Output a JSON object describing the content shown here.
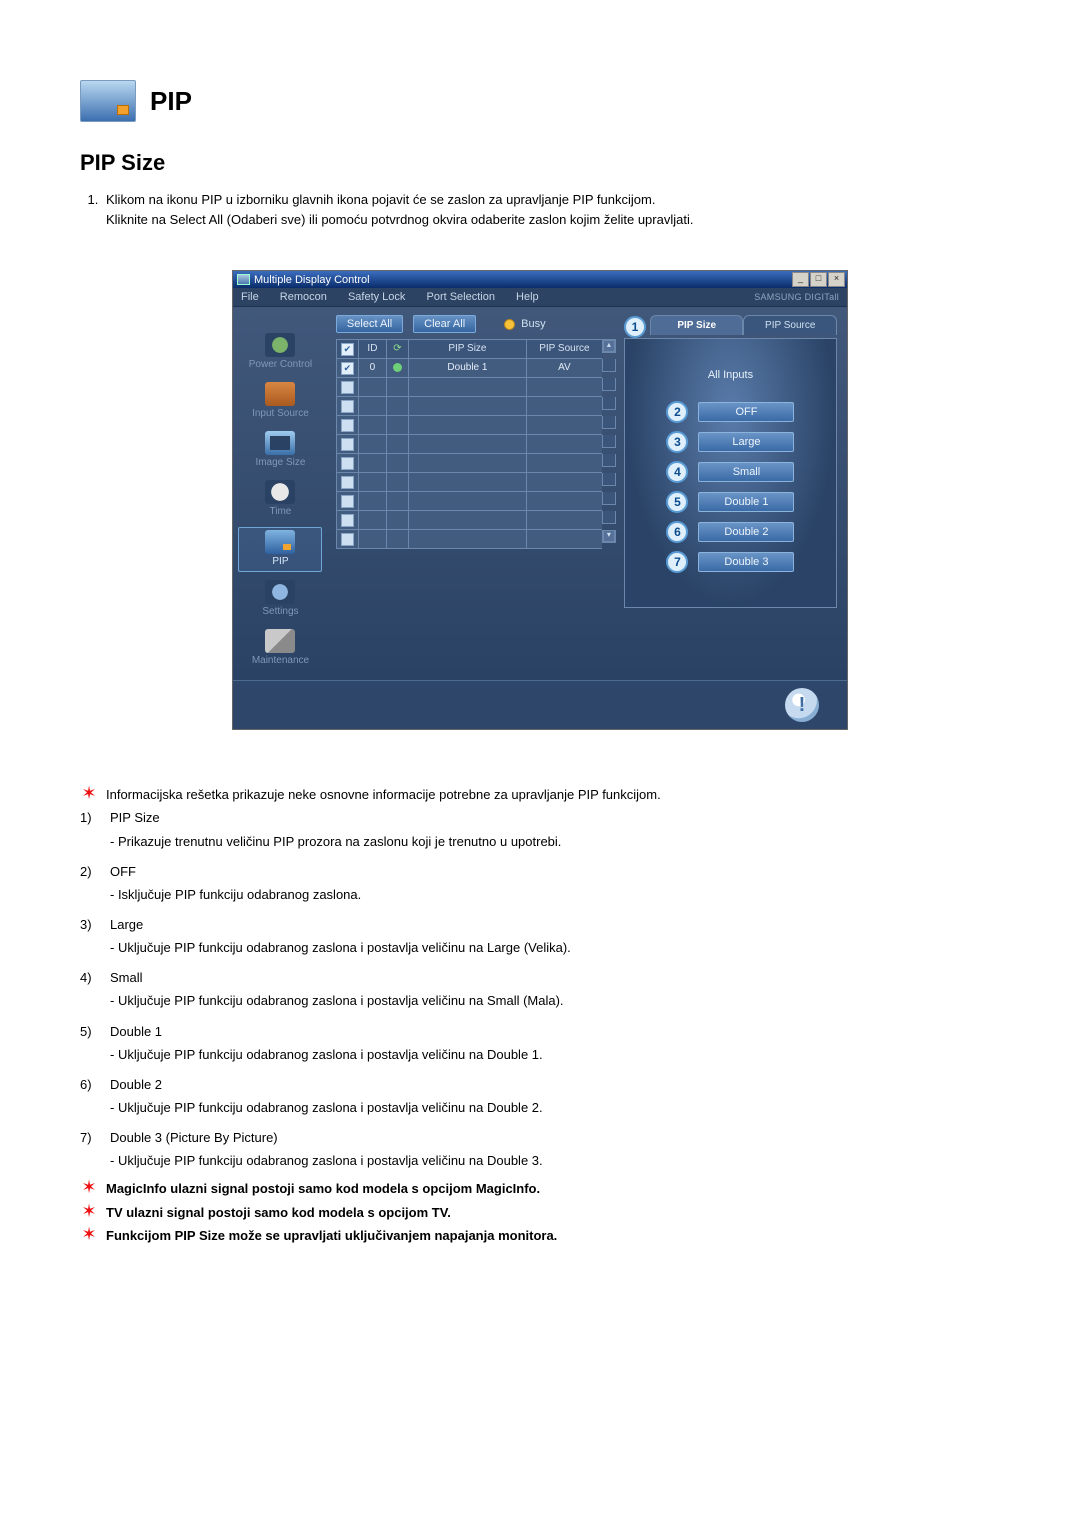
{
  "header": {
    "title": "PIP"
  },
  "section": {
    "title": "PIP Size"
  },
  "intro": {
    "item1": "Klikom na ikonu PIP u izborniku glavnih ikona pojavit će se zaslon za upravljanje PIP funkcijom.\nKliknite na Select All (Odaberi sve) ili pomoću potvrdnog okvira odaberite zaslon kojim želite upravljati."
  },
  "app": {
    "title": "Multiple Display Control",
    "menus": [
      "File",
      "Remocon",
      "Safety Lock",
      "Port Selection",
      "Help"
    ],
    "brand": "SAMSUNG DIGITall",
    "toolbar": {
      "select_all": "Select All",
      "clear_all": "Clear All",
      "busy": "Busy"
    },
    "sidebar": {
      "power": "Power Control",
      "input": "Input Source",
      "image": "Image Size",
      "time": "Time",
      "pip": "PIP",
      "settings": "Settings",
      "maint": "Maintenance"
    },
    "grid": {
      "headers": {
        "id": "ID",
        "pip_size": "PIP Size",
        "pip_source": "PIP Source"
      },
      "row": {
        "id": "0",
        "status_color": "#6fd07a",
        "pip_size": "Double 1",
        "pip_source": "AV"
      }
    },
    "right": {
      "tab_size": "PIP Size",
      "tab_source": "PIP Source",
      "all_inputs": "All Inputs",
      "options": {
        "off": "OFF",
        "large": "Large",
        "small": "Small",
        "double1": "Double 1",
        "double2": "Double 2",
        "double3": "Double 3"
      }
    }
  },
  "notes": {
    "info_grid": "Informacijska rešetka prikazuje neke osnovne informacije potrebne za upravljanje PIP funkcijom.",
    "n1_t": "PIP Size",
    "n1_d": "- Prikazuje trenutnu veličinu PIP prozora na zaslonu koji je trenutno u upotrebi.",
    "n2_t": "OFF",
    "n2_d": "- Isključuje PIP funkciju odabranog zaslona.",
    "n3_t": "Large",
    "n3_d": "- Uključuje PIP funkciju odabranog zaslona i postavlja veličinu na Large (Velika).",
    "n4_t": "Small",
    "n4_d": "- Uključuje PIP funkciju odabranog zaslona i postavlja veličinu na Small (Mala).",
    "n5_t": "Double 1",
    "n5_d": "- Uključuje PIP funkciju odabranog zaslona i postavlja veličinu na Double 1.",
    "n6_t": "Double 2",
    "n6_d": "- Uključuje PIP funkciju odabranog zaslona i postavlja veličinu na Double 2.",
    "n7_t": "Double 3 (Picture By Picture)",
    "n7_d": "- Uključuje PIP funkciju odabranog zaslona i postavlja veličinu na Double 3.",
    "bold1": "MagicInfo ulazni signal postoji samo kod modela s opcijom MagicInfo.",
    "bold2": "TV ulazni signal postoji samo kod modela s opcijom TV.",
    "bold3": "Funkcijom PIP Size može se upravljati uključivanjem napajanja monitora."
  }
}
